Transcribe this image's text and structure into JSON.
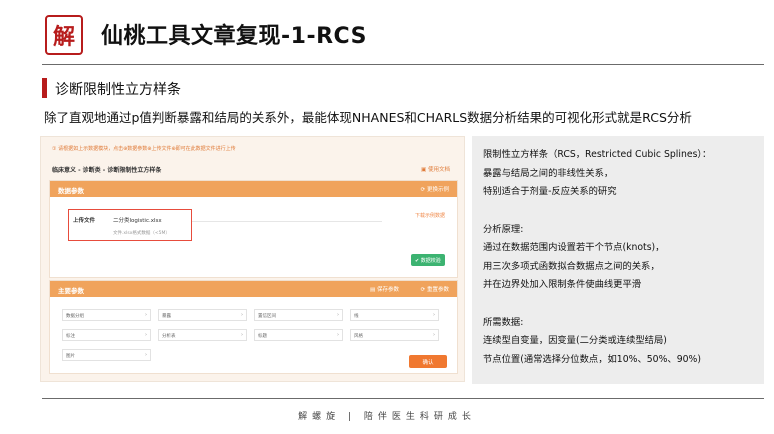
{
  "header": {
    "logo_text": "解",
    "title": "仙桃工具文章复现-1-RCS"
  },
  "section": {
    "title": "诊断限制性立方样条",
    "description": "除了直观地通过p值判断暴露和结局的关系外，最能体现NHANES和CHARLS数据分析结果的可视化形式就是RCS分析"
  },
  "app": {
    "tip": "① 请根据如上示数据模块，点击⊕数据参数⊕上传文件⊕即可在此数据文件进行上传",
    "breadcrumb": "临床意义 - 诊断类 - 诊断限制性立方样条",
    "help_label": "使用文档",
    "data_panel": {
      "title": "数据参数",
      "action": "更换示例",
      "upload_label": "上传文件",
      "file_name": "二分类logistic.xlsx",
      "file_hint": "文件.xlsx格式数据（<5M）",
      "change_label": "下载示例数据",
      "ok_label": "数据校验"
    },
    "main_panel": {
      "title": "主要参数",
      "action_save": "保存参数",
      "action_reset": "重置参数",
      "fields": [
        "数据分组",
        "暴露",
        "置信区间",
        "线",
        "标注",
        "分析表",
        "标题",
        "风格",
        "图片"
      ],
      "confirm_label": "确认"
    }
  },
  "info": {
    "lines_1": [
      "限制性立方样条（RCS，Restricted Cubic Splines）：",
      "暴露与结局之间的非线性关系，",
      "特别适合于剂量-反应关系的研究"
    ],
    "heading_2": "分析原理:",
    "lines_2": [
      "通过在数据范围内设置若干个节点(knots)，",
      "用三次多项式函数拟合数据点之间的关系，",
      "并在边界处加入限制条件使曲线更平滑"
    ],
    "heading_3": "所需数据:",
    "lines_3": [
      "连续型自变量，因变量(二分类或连续型结局)",
      "节点位置(通常选择分位数点，如10%、50%、90%)"
    ]
  },
  "footer": {
    "left": "解螺旋",
    "separator": "|",
    "right": "陪伴医生科研成长"
  },
  "colors": {
    "accent_red": "#b71c1c",
    "panel_orange": "#f0a35c",
    "button_orange": "#f07830",
    "button_green": "#3cb371"
  }
}
